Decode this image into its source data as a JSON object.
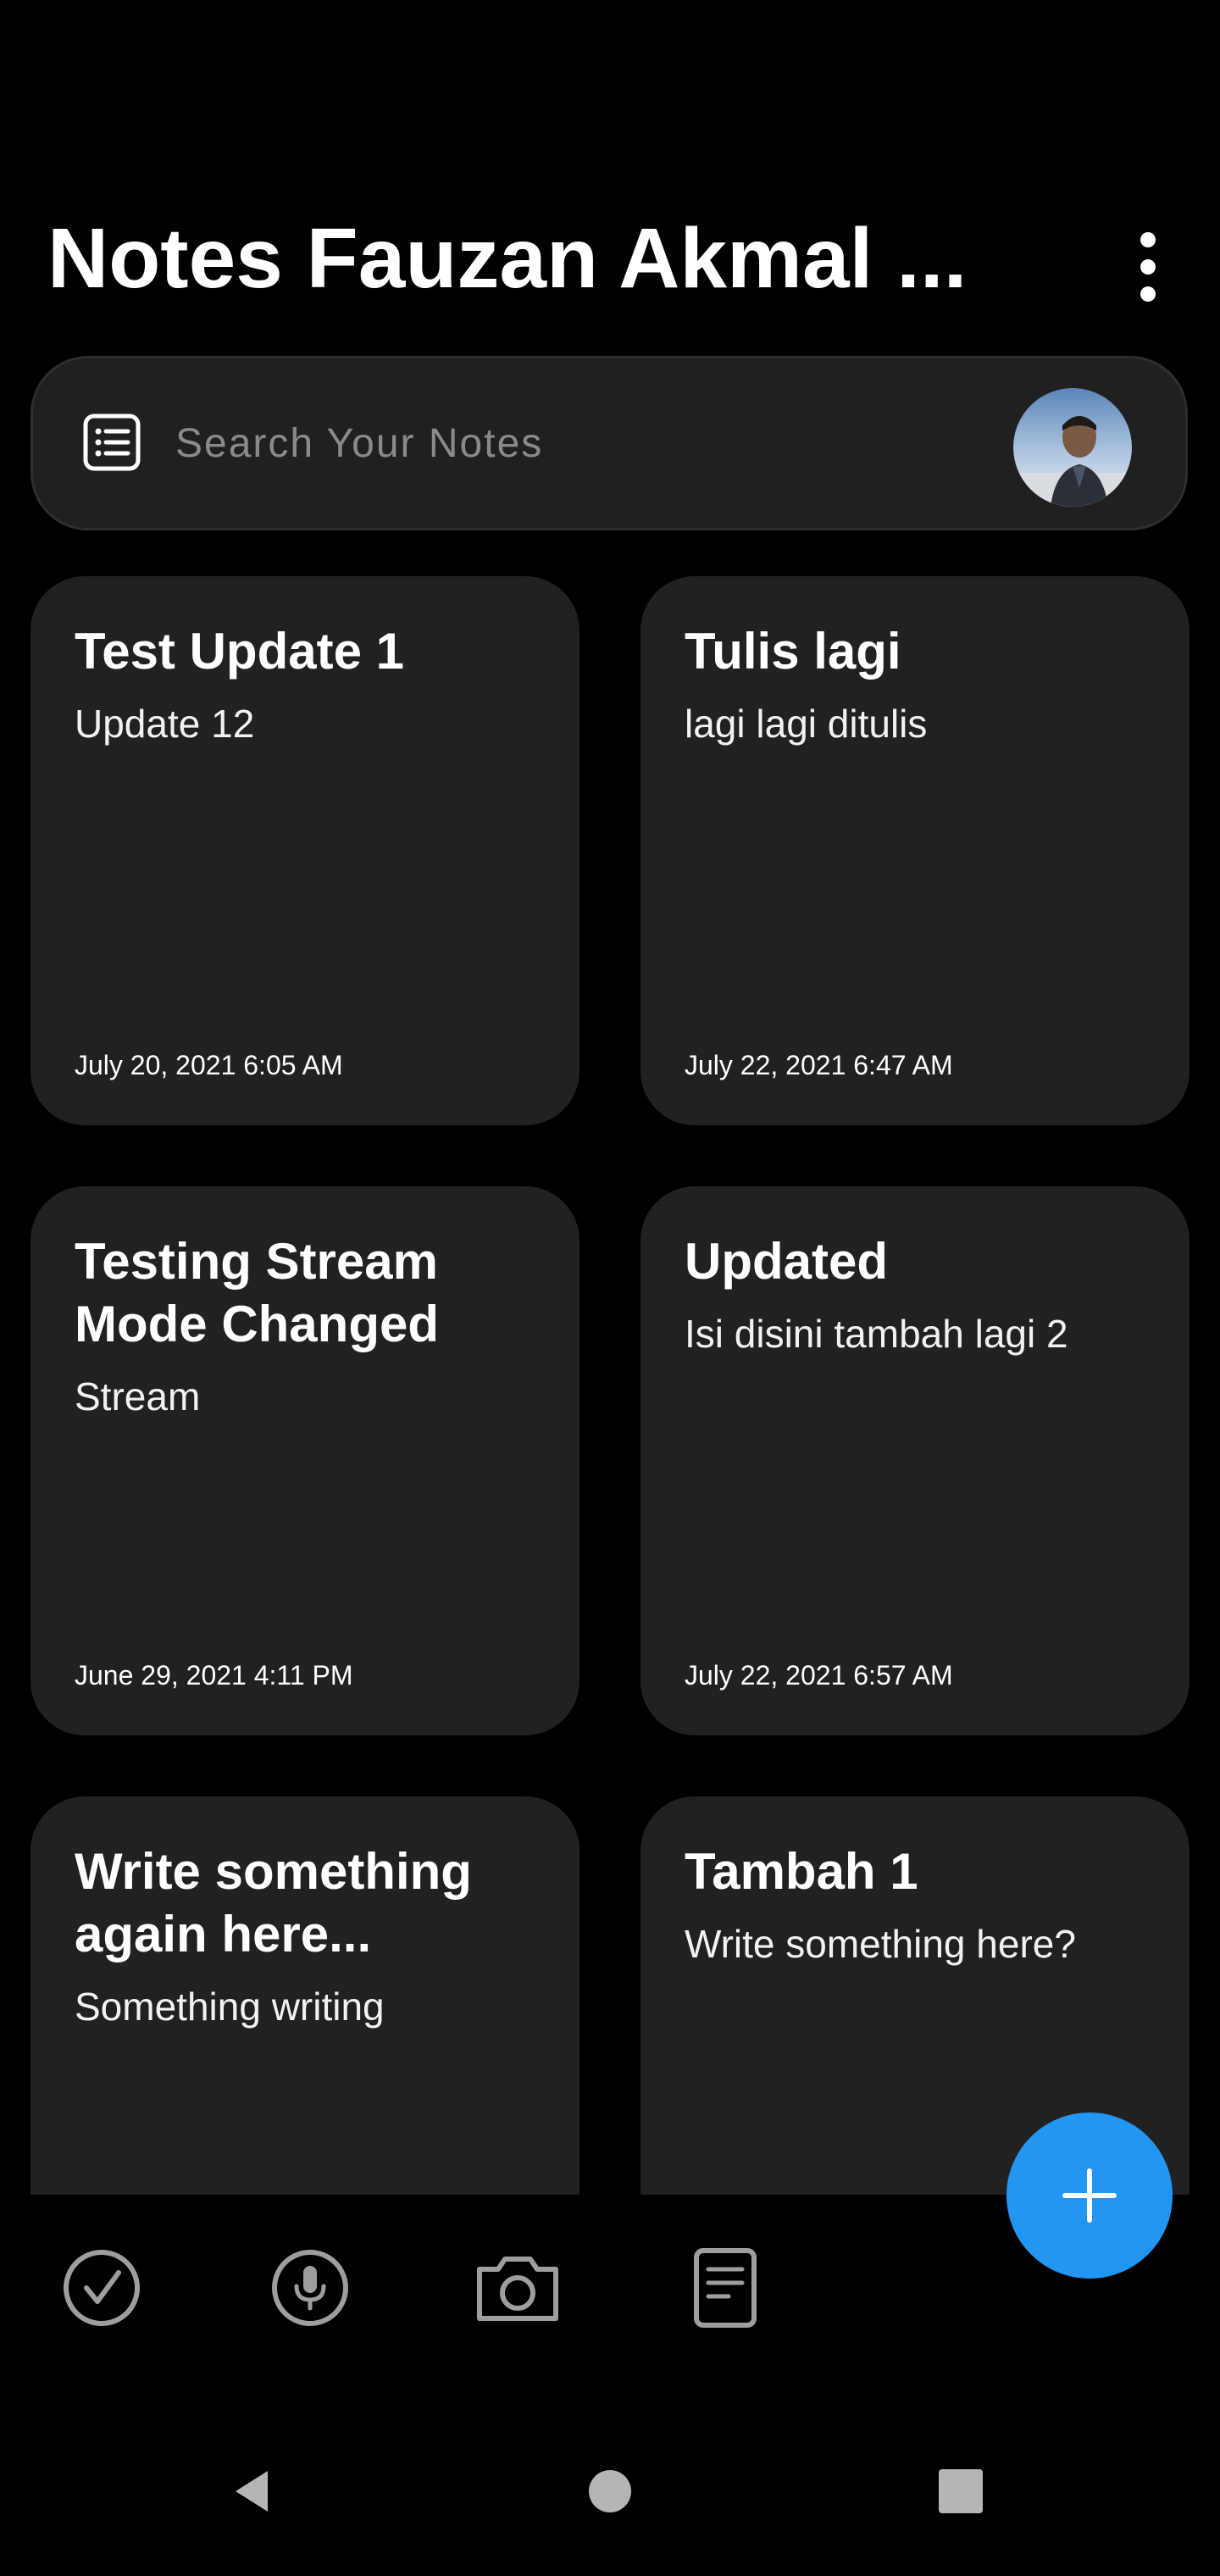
{
  "header": {
    "title": "Notes Fauzan Akmal ...",
    "menu_icon": "more-vert-icon"
  },
  "search": {
    "placeholder": "Search Your Notes",
    "leading_icon": "list-icon",
    "avatar": "user-avatar"
  },
  "notes": [
    {
      "title": "Test Update 1",
      "body": "Update 12",
      "date": "July 20, 2021 6:05 AM"
    },
    {
      "title": "Tulis lagi",
      "body": "lagi lagi ditulis",
      "date": "July 22, 2021 6:47 AM"
    },
    {
      "title": "Testing Stream Mode Changed",
      "body": "Stream",
      "date": "June 29, 2021 4:11 PM"
    },
    {
      "title": "Updated",
      "body": "Isi disini tambah lagi 2",
      "date": "July 22, 2021 6:57 AM"
    },
    {
      "title": "Write something again here...",
      "body": "Something writing",
      "date": ""
    },
    {
      "title": "Tambah 1",
      "body": "Write something here?",
      "date": ""
    }
  ],
  "fab": {
    "icon": "plus-icon",
    "color": "#2196f3"
  },
  "bottom_tools": [
    {
      "icon": "checkbox-icon"
    },
    {
      "icon": "microphone-icon"
    },
    {
      "icon": "camera-icon"
    },
    {
      "icon": "document-icon"
    }
  ],
  "nav": [
    {
      "icon": "back-triangle-icon"
    },
    {
      "icon": "home-circle-icon"
    },
    {
      "icon": "recents-square-icon"
    }
  ],
  "colors": {
    "background": "#000000",
    "card": "#212122",
    "accent": "#2196f3",
    "icon_gray": "#9e9e9e"
  }
}
